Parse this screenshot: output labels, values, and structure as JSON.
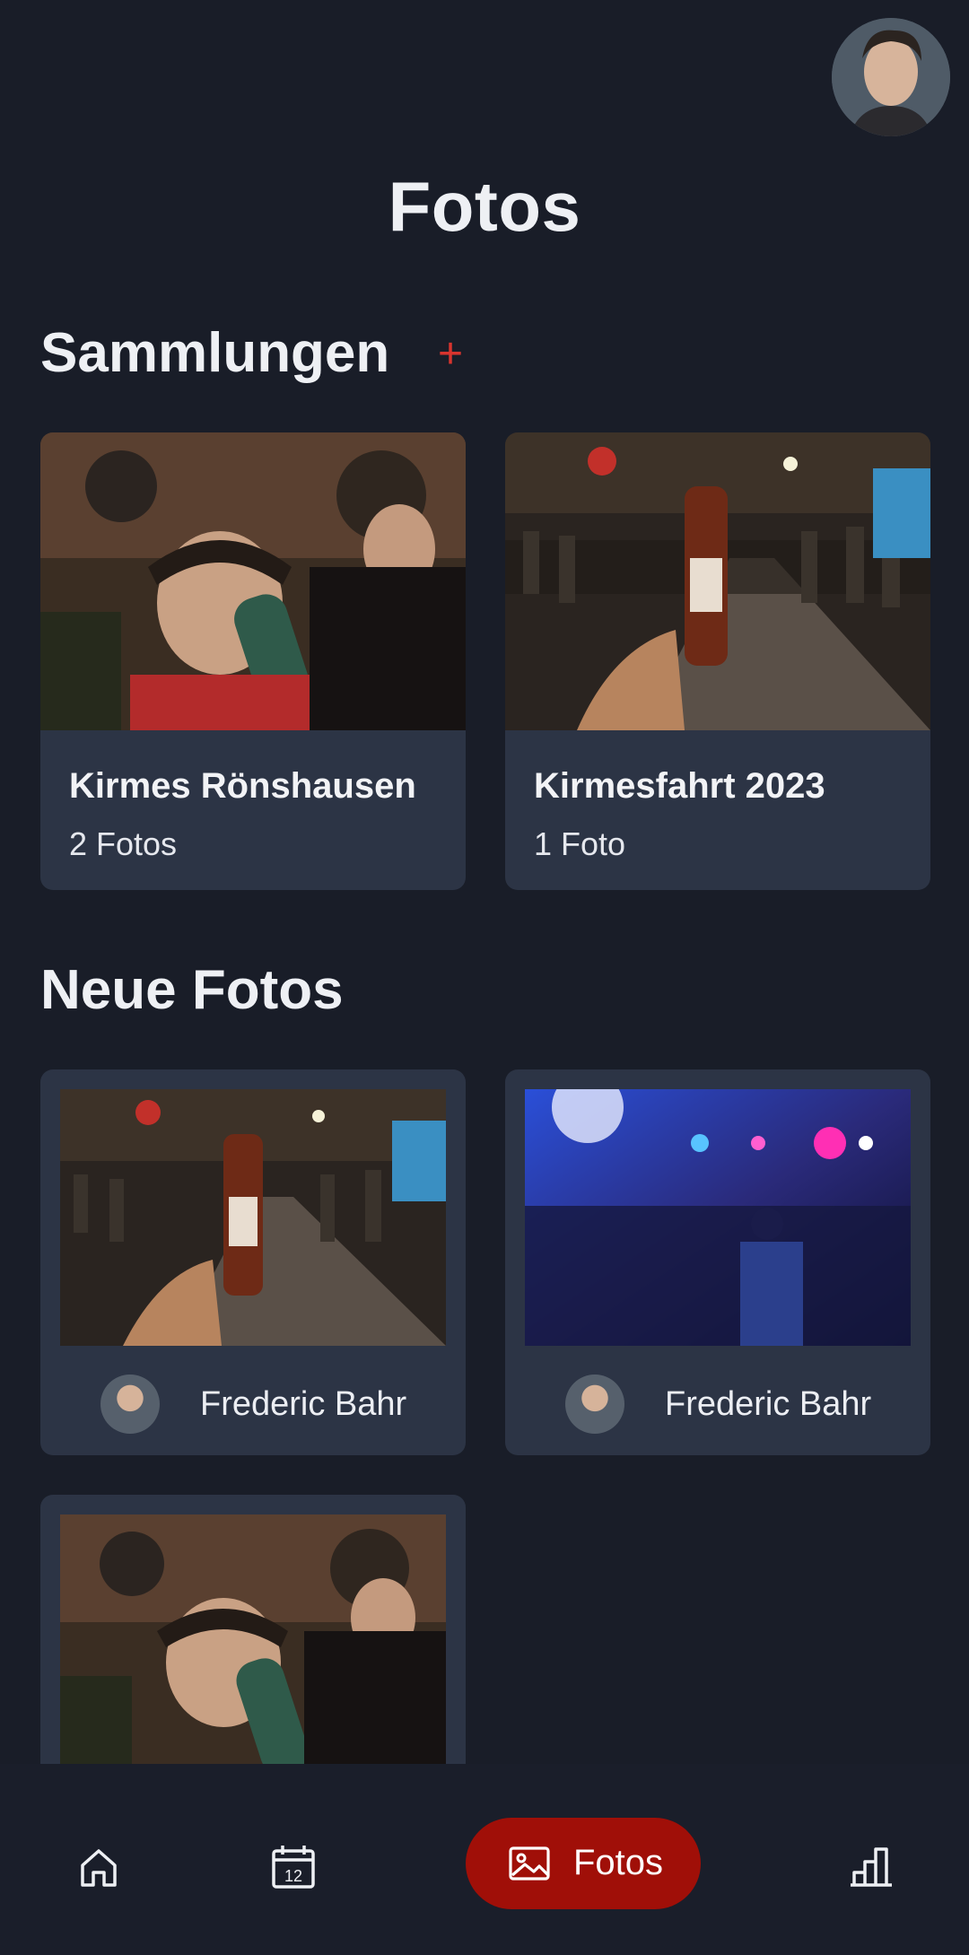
{
  "header": {
    "title": "Fotos"
  },
  "collections": {
    "title": "Sammlungen",
    "add_icon": "+",
    "items": [
      {
        "name": "Kirmes Rönshausen",
        "count": "2 Fotos"
      },
      {
        "name": "Kirmesfahrt 2023",
        "count": "1 Foto"
      }
    ]
  },
  "new_photos": {
    "title": "Neue Fotos",
    "items": [
      {
        "author": "Frederic Bahr"
      },
      {
        "author": "Frederic Bahr"
      }
    ]
  },
  "nav": {
    "items": [
      {
        "icon": "home-icon"
      },
      {
        "icon": "calendar-icon",
        "day": "12"
      },
      {
        "icon": "image-icon",
        "label": "Fotos",
        "active": true
      },
      {
        "icon": "bar-chart-icon"
      }
    ]
  },
  "colors": {
    "accent": "#a00f08",
    "plus": "#d8342e",
    "background": "#191d28",
    "card": "#2c3445"
  }
}
